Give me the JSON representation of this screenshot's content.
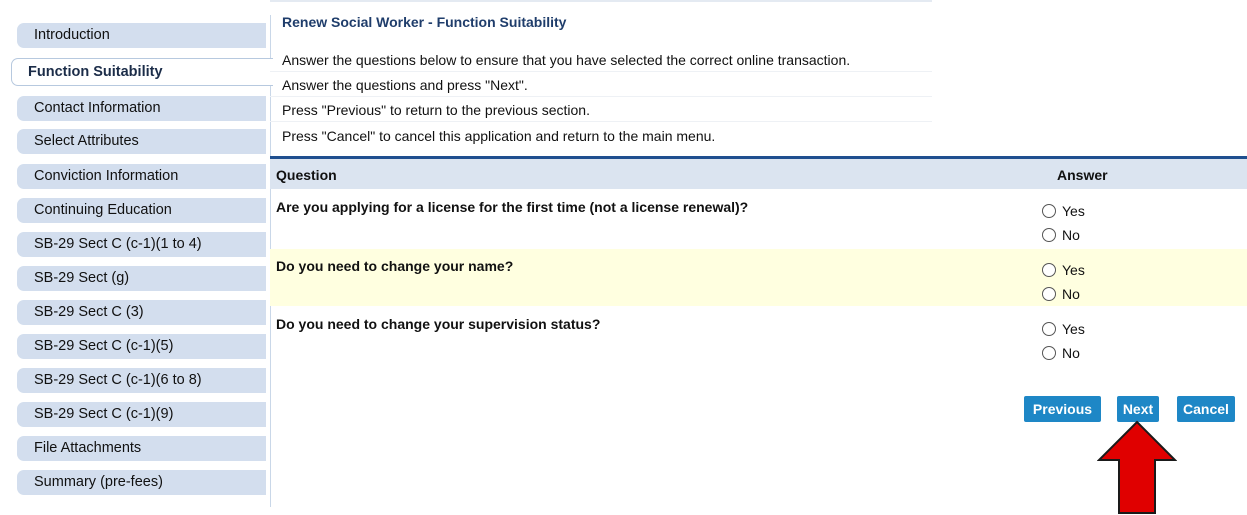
{
  "sidebar": {
    "items": [
      {
        "label": "Introduction",
        "active": false
      },
      {
        "label": "Function Suitability",
        "active": true
      },
      {
        "label": "Contact Information",
        "active": false
      },
      {
        "label": "Select Attributes",
        "active": false
      },
      {
        "label": "Conviction Information",
        "active": false
      },
      {
        "label": "Continuing Education",
        "active": false
      },
      {
        "label": "SB-29 Sect C (c-1)(1 to 4)",
        "active": false
      },
      {
        "label": "SB-29 Sect (g)",
        "active": false
      },
      {
        "label": "SB-29 Sect C (3)",
        "active": false
      },
      {
        "label": "SB-29 Sect C (c-1)(5)",
        "active": false
      },
      {
        "label": "SB-29 Sect C (c-1)(6 to 8)",
        "active": false
      },
      {
        "label": "SB-29 Sect C (c-1)(9)",
        "active": false
      },
      {
        "label": "File Attachments",
        "active": false
      },
      {
        "label": "Summary (pre-fees)",
        "active": false
      }
    ]
  },
  "main": {
    "title": "Renew Social Worker - Function Suitability",
    "instructions": [
      "Answer the questions below to ensure that you have selected the correct online transaction.",
      "Answer the questions and press \"Next\".",
      "Press \"Previous\" to return to the previous section.",
      "Press \"Cancel\" to cancel this application and return to the main menu."
    ],
    "table": {
      "headers": {
        "question": "Question",
        "answer": "Answer"
      },
      "rows": [
        {
          "question": "Are you applying for a license for the first time (not a license renewal)?",
          "options": [
            "Yes",
            "No"
          ]
        },
        {
          "question": "Do you need to change your name?",
          "options": [
            "Yes",
            "No"
          ]
        },
        {
          "question": "Do you need to change your supervision status?",
          "options": [
            "Yes",
            "No"
          ]
        }
      ]
    },
    "buttons": {
      "previous": "Previous",
      "next": "Next",
      "cancel": "Cancel"
    }
  },
  "annotation": {
    "arrow_color": "#e00000",
    "row_highlight_color": "#ffffe0",
    "accent_color": "#1e87c6"
  }
}
